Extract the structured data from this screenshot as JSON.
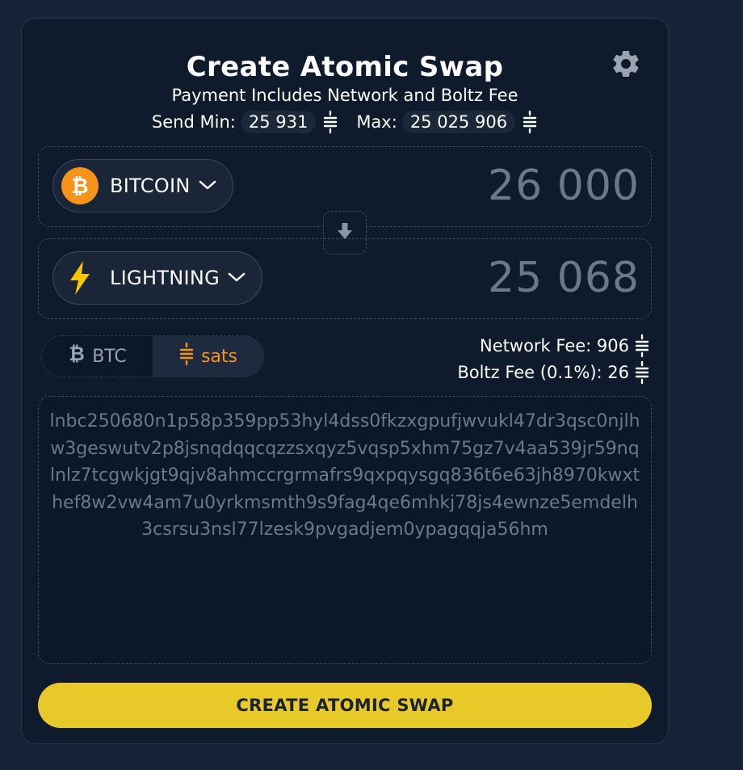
{
  "header": {
    "title": "Create Atomic Swap",
    "subtitle": "Payment Includes Network and Boltz Fee",
    "min_label": "Send Min:",
    "min_value": "25 931",
    "max_label": "Max:",
    "max_value": "25 025 906"
  },
  "send": {
    "asset": "BITCOIN",
    "amount": "26 000",
    "icon": "bitcoin-icon",
    "color": "#f7931a"
  },
  "receive": {
    "asset": "LIGHTNING",
    "amount": "25 068",
    "icon": "lightning-bolt-icon",
    "color": "#f6c600"
  },
  "denomination": {
    "options": [
      "BTC",
      "sats"
    ],
    "selected": "sats"
  },
  "fees": {
    "network_label": "Network Fee: 906",
    "boltz_label": "Boltz Fee (0.1%): 26"
  },
  "invoice": {
    "value": "lnbc250680n1p58p359pp53hyl4dss0fkzxgpufjwvukl47dr3qsc0njlhw3geswutv2p8jsnqdqqcqzzsxqyz5vqsp5xhm75gz7v4aa539jr59nqlnlz7tcgwkjgt9qjv8ahmccrgrmafrs9qxpqysgq836t6e63jh8970kwxthef8w2vw4am7u0yrkmsmth9s9fag4qe6mhkj78js4ewnze5emdelh3csrsu3nsl77lzesk9pvgadjem0ypagqqja56hm"
  },
  "action": {
    "create_label": "CREATE ATOMIC SWAP"
  },
  "colors": {
    "accent": "#e8c92a",
    "background": "#172337",
    "card": "#0f1b2c",
    "muted_text": "#6d7787"
  }
}
